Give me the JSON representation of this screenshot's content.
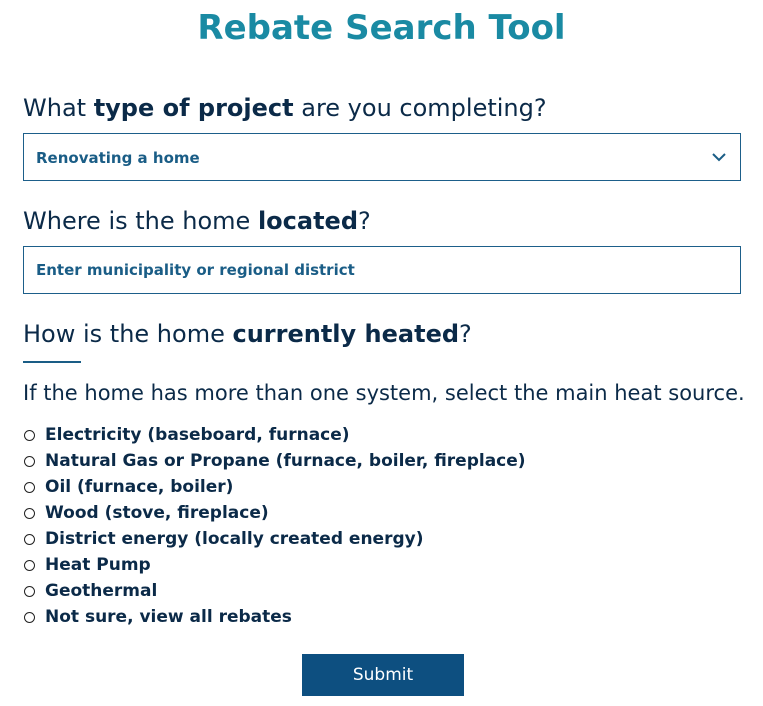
{
  "page": {
    "title": "Rebate Search Tool"
  },
  "q1": {
    "pre": "What ",
    "bold": "type of project",
    "post": " are you completing?",
    "selected_value": "Renovating a home"
  },
  "q2": {
    "pre": "Where is the home ",
    "bold": "located",
    "post": "?",
    "placeholder": "Enter municipality or regional district"
  },
  "q3": {
    "pre": "How is the home ",
    "bold": "currently heated",
    "post": "?",
    "helper": "If the home has more than one system, select the main heat source.",
    "options": [
      "Electricity (baseboard, furnace)",
      "Natural Gas or Propane (furnace, boiler, fireplace)",
      "Oil (furnace, boiler)",
      "Wood (stove, fireplace)",
      "District energy (locally created energy)",
      "Heat Pump",
      "Geothermal",
      "Not sure, view all rebates"
    ]
  },
  "submit_label": "Submit",
  "colors": {
    "title": "#1a8aa3",
    "text": "#0b2a48",
    "field_text": "#1a5d86",
    "border": "#1d5f8a",
    "button": "#0d4f80"
  }
}
